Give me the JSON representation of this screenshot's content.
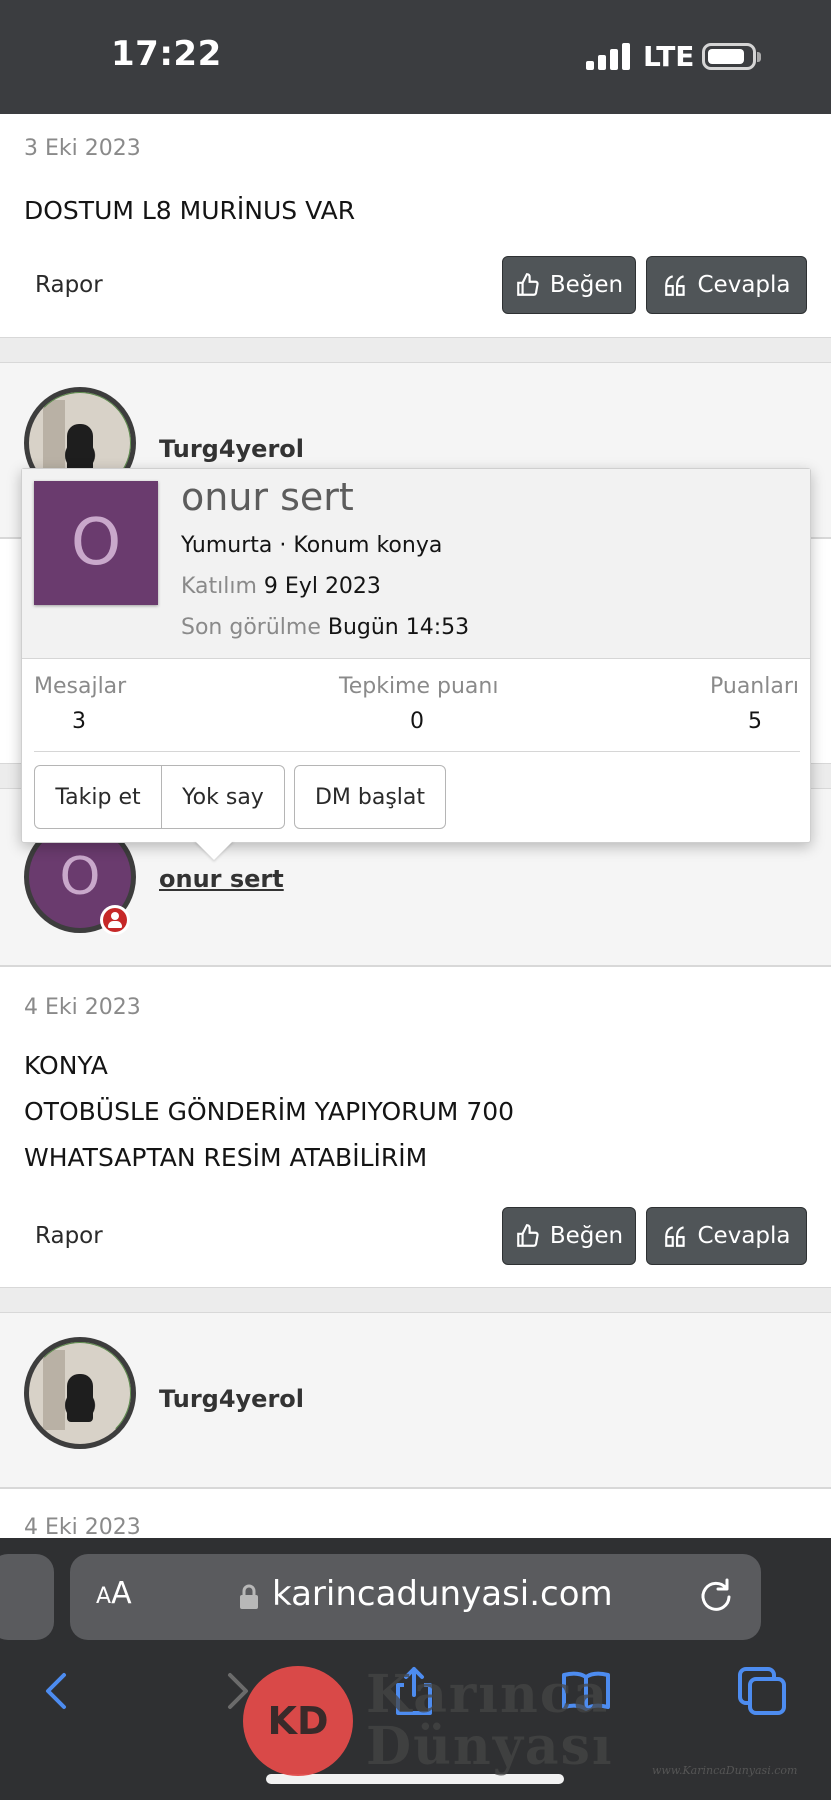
{
  "status_bar": {
    "time": "17:22",
    "network": "LTE"
  },
  "posts": [
    {
      "date": "3 Eki 2023",
      "lines": [
        "DOSTUM L8 MURİNUS VAR"
      ],
      "report": "Rapor",
      "like": "Beğen",
      "reply": "Cevapla"
    },
    {
      "date": "4 Eki 2023",
      "lines": [
        "KONYA",
        "OTOBÜSLE GÖNDERİM YAPIYORUM 700",
        "WHATSAPTAN RESİM ATABİLİRİM"
      ],
      "report": "Rapor",
      "like": "Beğen",
      "reply": "Cevapla"
    }
  ],
  "users": {
    "turg": "Turg4yerol",
    "onur": "onur sert",
    "onur_initial": "O"
  },
  "next_date": "4 Eki 2023",
  "popup": {
    "initial": "O",
    "name": "onur sert",
    "subtitle": "Yumurta · Konum konya",
    "joined_label": "Katılım",
    "joined_value": "9 Eyl 2023",
    "seen_label": "Son görülme",
    "seen_value": "Bugün 14:53",
    "stats": [
      {
        "label": "Mesajlar",
        "value": "3"
      },
      {
        "label": "Tepkime puanı",
        "value": "0"
      },
      {
        "label": "Puanları",
        "value": "5"
      }
    ],
    "buttons": {
      "follow": "Takip et",
      "ignore": "Yok say",
      "dm": "DM başlat"
    }
  },
  "browser": {
    "aa_small": "A",
    "aa_large": "A",
    "url": "karincadunyasi.com"
  },
  "watermark": {
    "logo": "KD",
    "line1": "Karınca",
    "line2": "Dünyası",
    "url": "www.KarincaDunyasi.com"
  },
  "colors": {
    "button_bg": "#505558",
    "avatar_purple": "#6a3b6e",
    "status_red": "#c62828",
    "status_bar": "#3b3d40"
  }
}
